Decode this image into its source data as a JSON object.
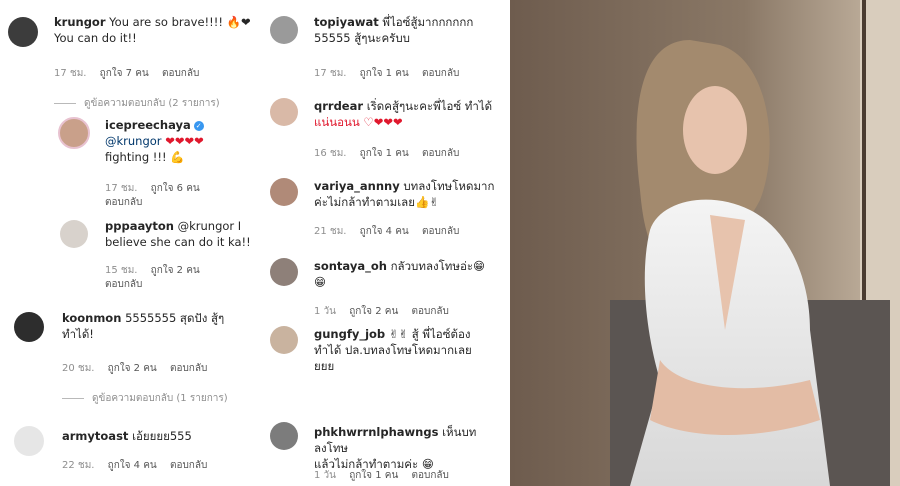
{
  "left": {
    "c1": {
      "user": "krungor",
      "text": "You are so brave!!!! 🔥❤",
      "text2": "You can do it!!",
      "time": "17 ชม.",
      "likes": "ถูกใจ 7 คน",
      "reply": "ตอบกลับ"
    },
    "view1": "ดูข้อความตอบกลับ (2 รายการ)",
    "r1": {
      "user": "icepreechaya",
      "mention": "@krungor",
      "hearts": "❤❤❤❤",
      "text2": "fighting !!! 💪",
      "time": "17 ชม.",
      "likes": "ถูกใจ 6 คน",
      "reply": "ตอบกลับ"
    },
    "r2": {
      "user": "pppaayton",
      "text": "@krungor I",
      "text2": "believe she can do it ka!!",
      "time": "15 ชม.",
      "likes": "ถูกใจ 2 คน",
      "reply": "ตอบกลับ"
    },
    "c2": {
      "user": "koonmon",
      "text": "5555555 สุดปัง สู้ๆ",
      "text2": "ทำได้!",
      "time": "20 ชม.",
      "likes": "ถูกใจ 2 คน",
      "reply": "ตอบกลับ"
    },
    "view2": "ดูข้อความตอบกลับ (1 รายการ)",
    "c3": {
      "user": "armytoast",
      "text": "เอ้ยยยย555",
      "time": "22 ชม.",
      "likes": "ถูกใจ 4 คน",
      "reply": "ตอบกลับ"
    }
  },
  "mid": {
    "c1": {
      "user": "topiyawat",
      "text": "พี่ไอซ์สู้มากกกกกก",
      "text2": "55555 สู้ๆนะครับบ",
      "time": "17 ชม.",
      "likes": "ถูกใจ 1 คน",
      "reply": "ตอบกลับ"
    },
    "c2": {
      "user": "qrrdear",
      "text": "เริ่ดคสู้ๆนะคะพี่ไอซ์ ทำได้",
      "text2": "แน่นอนน ♡❤❤❤",
      "time": "16 ชม.",
      "likes": "ถูกใจ 1 คน",
      "reply": "ตอบกลับ"
    },
    "c3": {
      "user": "variya_annny",
      "text": "บทลงโทษโหดมาก",
      "text2": "ค่ะไม่กล้าทำตามเลย👍✌",
      "time": "21 ชม.",
      "likes": "ถูกใจ 4 คน",
      "reply": "ตอบกลับ"
    },
    "c4": {
      "user": "sontaya_oh",
      "text": "กลัวบทลงโทษอ่ะ😁",
      "text2": "😁",
      "time": "1 วัน",
      "likes": "ถูกใจ 2 คน",
      "reply": "ตอบกลับ"
    },
    "c5": {
      "user": "gungfy_job",
      "text": "✌✌ สู้ พี่ไอซ์ต้อง",
      "text2": "ทำได้ ปล.บทลงโทษโหดมากเลย",
      "text3": "ยยย",
      "time": "",
      "likes": "",
      "reply": ""
    },
    "c6": {
      "user": "phkhwrrnlphawngs",
      "text": "เห็นบทลงโทษ",
      "text2": "แล้วไม่กล้าทำตามค่ะ 😁",
      "time": "1 วัน",
      "likes": "ถูกใจ 1 คน",
      "reply": "ตอบกลับ"
    }
  }
}
